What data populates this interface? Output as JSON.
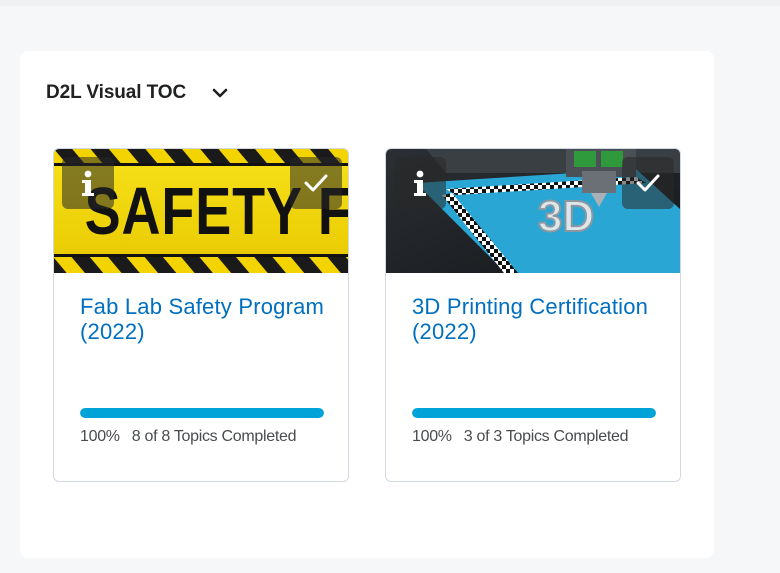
{
  "widget": {
    "title": "D2L Visual TOC"
  },
  "cards": [
    {
      "title": "Fab Lab Safety Program (2022)",
      "image_text": "SAFETY FI",
      "percent_label": "100%",
      "progress": 1.0,
      "completed_label": "8 of 8 Topics Completed"
    },
    {
      "title": "3D Printing Certification (2022)",
      "image_text": "3D",
      "percent_label": "100%",
      "progress": 1.0,
      "completed_label": "3 of 3 Topics Completed"
    }
  ],
  "icons": {
    "dropdown": "chevron-down-icon",
    "info": "info-icon",
    "complete": "checkmark-icon"
  },
  "colors": {
    "link": "#006fbf",
    "progress": "#00a3d8",
    "hazard_yellow": "#f3d400",
    "hazard_black": "#1a1a1a",
    "printer_bed": "#2aa6d4"
  }
}
